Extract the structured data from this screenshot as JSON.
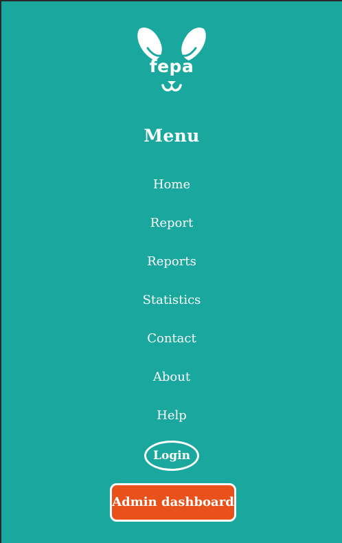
{
  "brand": {
    "logo_text": "fepa",
    "logo_icon": "rabbit-face-icon"
  },
  "menu": {
    "title": "Menu",
    "items": [
      {
        "label": "Home"
      },
      {
        "label": "Report"
      },
      {
        "label": "Reports"
      },
      {
        "label": "Statistics"
      },
      {
        "label": "Contact"
      },
      {
        "label": "About"
      },
      {
        "label": "Help"
      }
    ],
    "login_label": "Login",
    "admin_label": "Admin dashboard"
  },
  "colors": {
    "background": "#1aa89e",
    "accent": "#e8521a",
    "text": "#ffffff"
  }
}
